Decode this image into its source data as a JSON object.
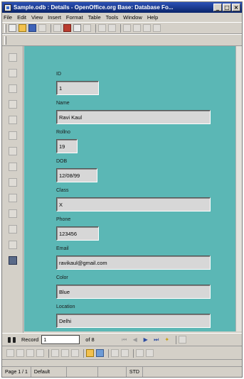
{
  "window": {
    "title": "Sample.odb : Details - OpenOffice.org Base: Database Fo...",
    "controls": [
      "minimize-icon",
      "maximize-icon",
      "close-icon"
    ]
  },
  "menu": [
    "File",
    "Edit",
    "View",
    "Insert",
    "Format",
    "Table",
    "Tools",
    "Window",
    "Help"
  ],
  "form": {
    "fields": [
      {
        "label": "ID",
        "value": "1"
      },
      {
        "label": "Name",
        "value": "Ravi Kaul"
      },
      {
        "label": "Rollno",
        "value": "19"
      },
      {
        "label": "DOB",
        "value": "12/08/99"
      },
      {
        "label": "Class",
        "value": "X"
      },
      {
        "label": "Phone",
        "value": "123456"
      },
      {
        "label": "Email",
        "value": "ravikaul@gmail.com"
      },
      {
        "label": "Color",
        "value": "Blue"
      },
      {
        "label": "Location",
        "value": "Delhi"
      }
    ],
    "background": "#5bb7b5"
  },
  "navigation": {
    "record_label": "Record",
    "record_value": "1",
    "of_label": "of 8"
  },
  "status": {
    "page": "Page 1 / 1",
    "style": "Default",
    "mode": "STD"
  }
}
